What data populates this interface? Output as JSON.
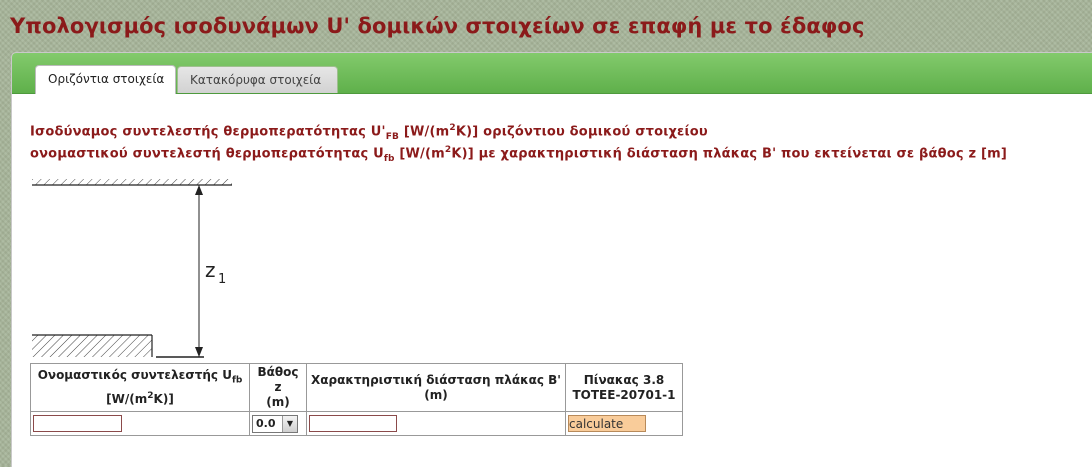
{
  "page": {
    "title": "Υπολογισμός ισοδυνάμων U' δομικών στοιχείων σε επαφή με το έδαφος"
  },
  "tabs": [
    {
      "label": "Οριζόντια στοιχεία",
      "active": true
    },
    {
      "label": "Κατακόρυφα στοιχεία",
      "active": false
    }
  ],
  "heading": {
    "line1_a": "Ισοδύναμος συντελεστής θερμοπερατότητας U'",
    "line1_sub": "FB",
    "line1_b": " [W/(m",
    "line1_sup": "2",
    "line1_c": "K)] οριζόντιου δομικού στοιχείου",
    "line2_a": "ονομαστικού συντελεστή θερμοπερατότητας U",
    "line2_sub": "fb",
    "line2_b": " [W/(m",
    "line2_sup": "2",
    "line2_c": "K)] με χαρακτηριστική διάσταση πλάκας B' που εκτείνεται σε βάθος z [m]"
  },
  "diagram": {
    "label_main": "z",
    "label_sub": "1"
  },
  "table": {
    "col1_a": "Ονομαστικός συντελεστής U",
    "col1_sub": "fb",
    "col1_b": "[W/(m",
    "col1_sup": "2",
    "col1_c": "K)]",
    "col2_line1": "Βάθος z",
    "col2_line2": "(m)",
    "col3_line1": "Χαρακτηριστική διάσταση πλάκας B'",
    "col3_line2": "(m)",
    "col4_line1": "Πίνακας 3.8",
    "col4_line2": "TOTEE-20701-1",
    "uf_value": "",
    "depth_selected": "0.0",
    "b_value": "",
    "calculate_label": "calculate"
  },
  "colors": {
    "title": "#8b1a1a",
    "tabbar": "#6dbb57",
    "button": "#f9cc9a"
  }
}
